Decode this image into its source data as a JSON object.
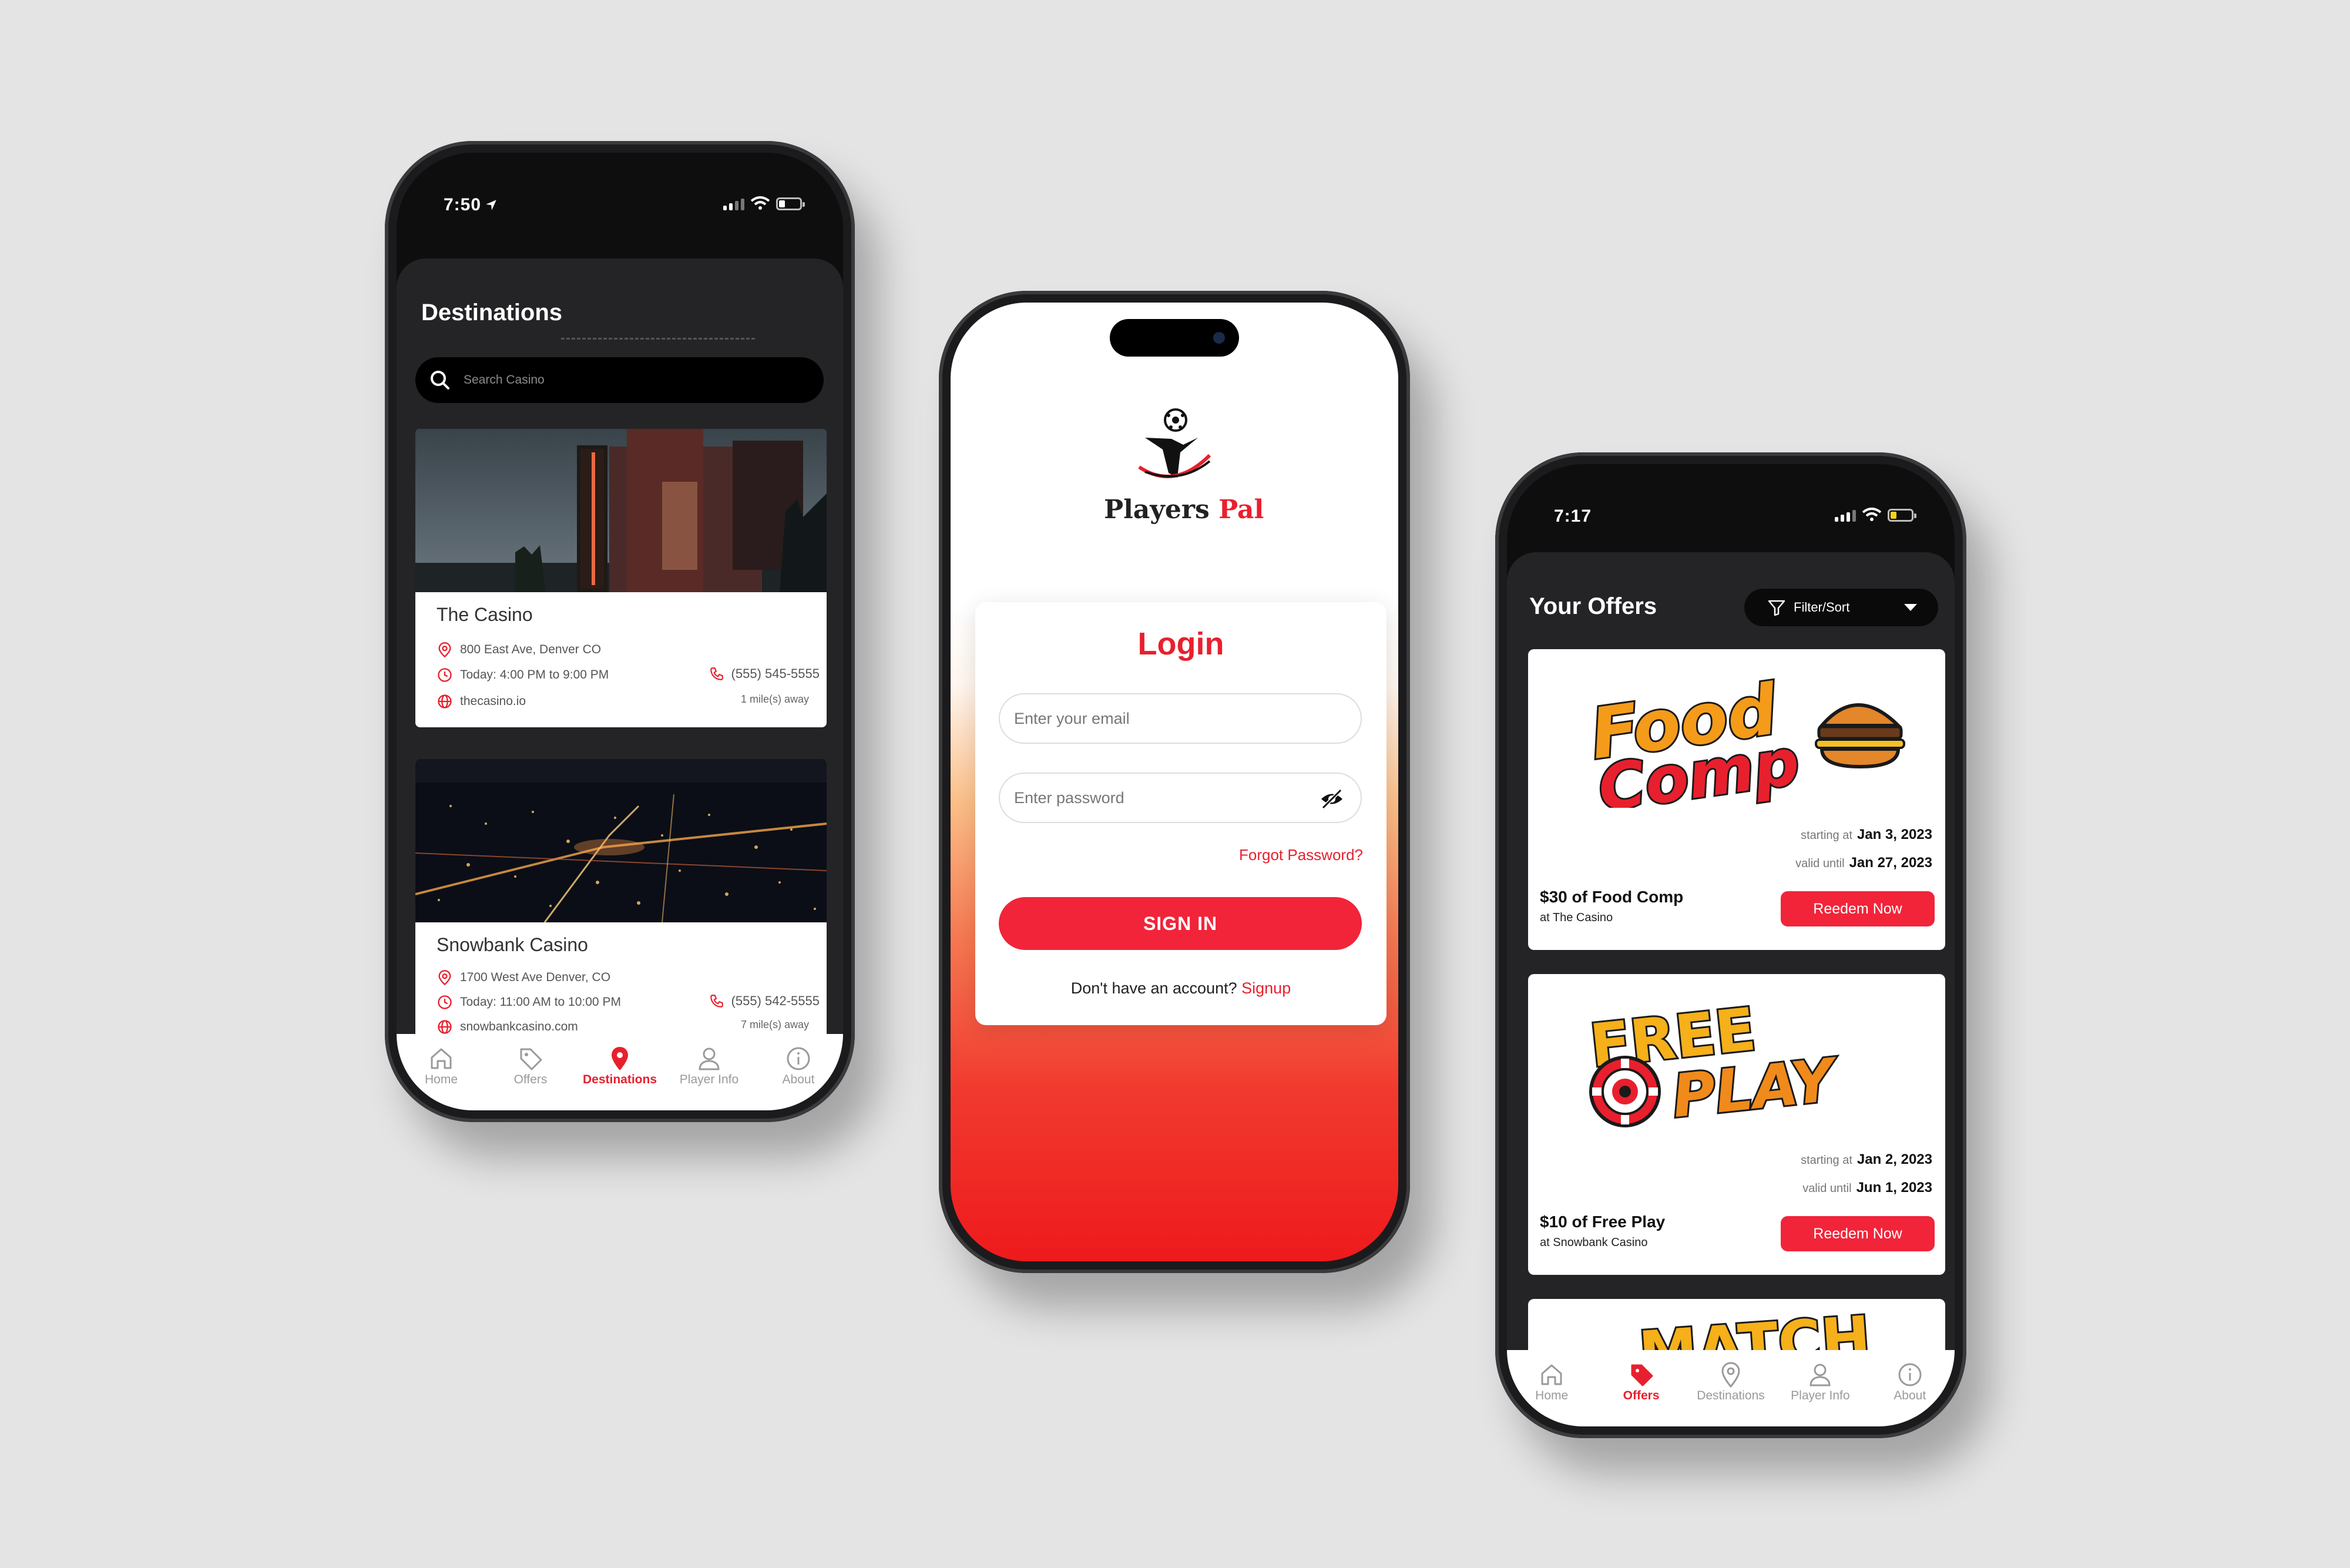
{
  "left_phone": {
    "status_time": "7:50",
    "title": "Destinations",
    "search_placeholder": "Search Casino",
    "casinos": [
      {
        "name": "The Casino",
        "address": "800 East Ave, Denver CO",
        "hours": "Today: 4:00 PM to 9:00 PM",
        "phone": "(555) 545-5555",
        "website": "thecasino.io",
        "distance": "1 mile(s) away"
      },
      {
        "name": "Snowbank Casino",
        "address": "1700 West Ave Denver, CO",
        "hours": "Today: 11:00 AM to 10:00 PM",
        "phone": "(555) 542-5555",
        "website": "snowbankcasino.com",
        "distance": "7 mile(s) away"
      }
    ],
    "tabs": [
      "Home",
      "Offers",
      "Destinations",
      "Player Info",
      "About"
    ],
    "active_tab": "Destinations"
  },
  "middle_phone": {
    "logo_text_1": "Players",
    "logo_text_2": "Pal",
    "login_title": "Login",
    "email_placeholder": "Enter your email",
    "password_placeholder": "Enter password",
    "forgot_password": "Forgot Password?",
    "sign_in": "SIGN IN",
    "no_account": "Don't have an account?",
    "signup": "Signup"
  },
  "right_phone": {
    "status_time": "7:17",
    "title": "Your Offers",
    "filter_label": "Filter/Sort",
    "offers": [
      {
        "art_line1": "Food",
        "art_line2": "Comp",
        "start_label": "starting at",
        "start_date": "Jan 3, 2023",
        "valid_label": "valid until",
        "valid_date": "Jan 27, 2023",
        "name": "$30 of Food Comp",
        "place": "at The Casino",
        "button": "Reedem Now"
      },
      {
        "art_line1": "FREE",
        "art_line2": "PLAY",
        "start_label": "starting at",
        "start_date": "Jan 2, 2023",
        "valid_label": "valid until",
        "valid_date": "Jun 1, 2023",
        "name": "$10 of Free Play",
        "place": "at Snowbank Casino",
        "button": "Reedem Now"
      }
    ],
    "partial_card_art": "MATCH",
    "tabs": [
      "Home",
      "Offers",
      "Destinations",
      "Player Info",
      "About"
    ],
    "active_tab": "Offers"
  },
  "colors": {
    "accent_red": "#e8202e",
    "button_red": "#f1243a",
    "dark_panel": "#242426",
    "background": "#e4e4e5"
  },
  "icons": [
    "search-icon",
    "location-pin-icon",
    "clock-icon",
    "globe-icon",
    "phone-icon",
    "home-icon",
    "tag-icon",
    "user-icon",
    "info-icon",
    "eye-off-icon",
    "filter-icon",
    "caret-down-icon",
    "location-arrow-icon"
  ]
}
